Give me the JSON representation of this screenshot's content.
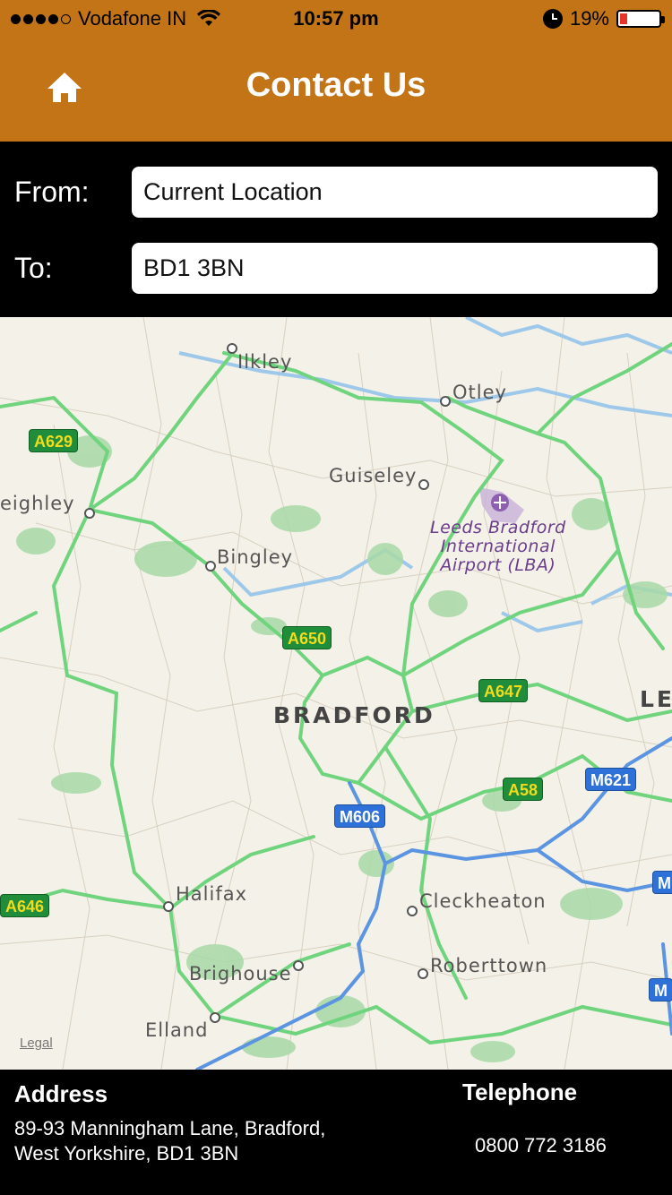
{
  "status_bar": {
    "carrier": "Vodafone IN",
    "time": "10:57 pm",
    "battery": "19%",
    "battery_level": 0.19,
    "signal_bars_filled": 4,
    "signal_bars_total": 5
  },
  "header": {
    "title": "Contact Us",
    "home_icon": "home-icon",
    "color": "#c27416"
  },
  "route": {
    "from_label": "From:",
    "from_value": "Current Location",
    "to_label": "To:",
    "to_value": "BD1 3BN"
  },
  "map": {
    "places": {
      "ilkley": "Ilkley",
      "otley": "Otley",
      "guiseley": "Guiseley",
      "keighley": "eighley",
      "bingley": "Bingley",
      "bradford": "BRADFORD",
      "leeds_partial": "LE",
      "halifax": "Halifax",
      "cleckheaton": "Cleckheaton",
      "brighouse": "Brighouse",
      "roberttown": "Roberttown",
      "elland": "Elland"
    },
    "airport": {
      "line1": "Leeds Bradford",
      "line2": "International",
      "line3": "Airport (LBA)"
    },
    "roads": {
      "a629": "A629",
      "a650": "A650",
      "a647": "A647",
      "a58": "A58",
      "a646": "A646",
      "m606": "M606",
      "m621": "M621",
      "m_edge1": "M",
      "m_edge2": "M"
    },
    "legal": "Legal"
  },
  "footer": {
    "address_title": "Address",
    "address_text": "89-93 Manningham Lane, Bradford, West Yorkshire, BD1 3BN",
    "telephone_title": "Telephone",
    "telephone_text": "0800 772 3186"
  }
}
